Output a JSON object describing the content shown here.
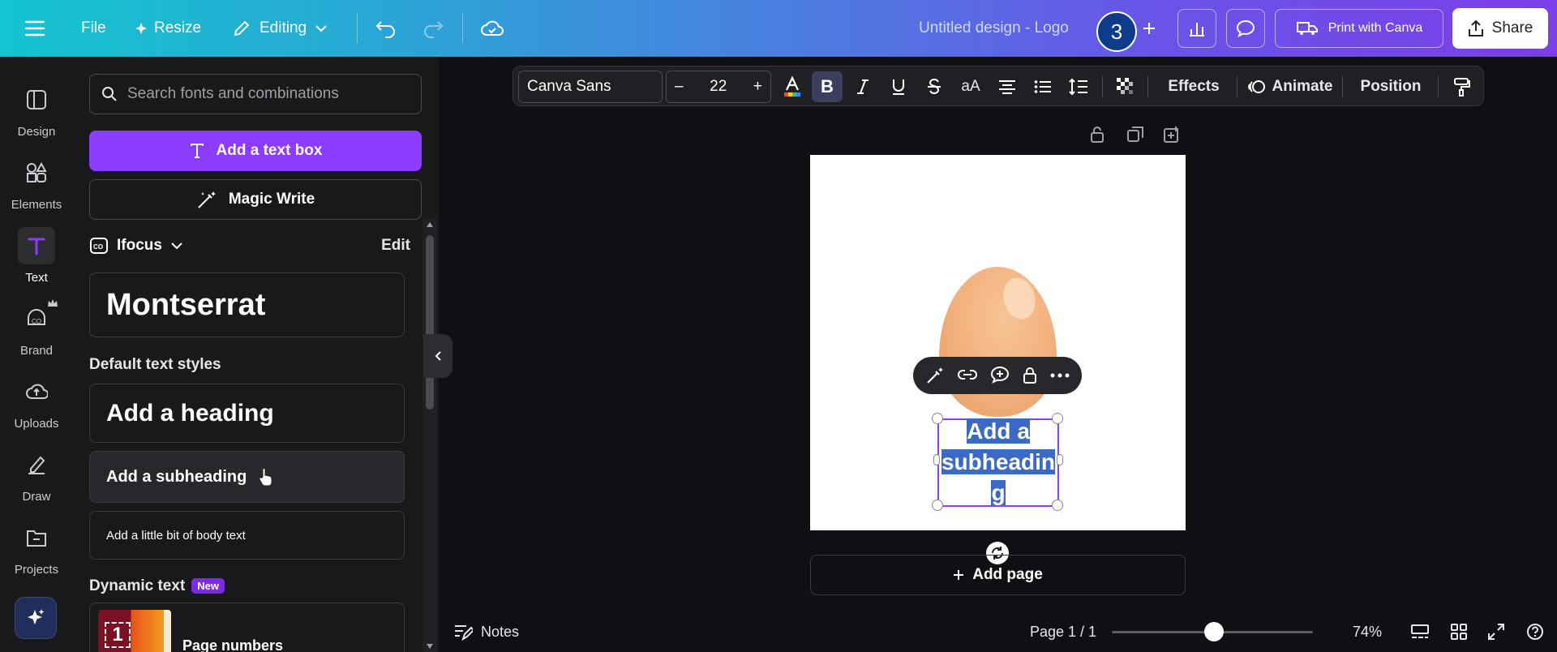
{
  "topbar": {
    "file": "File",
    "resize": "Resize",
    "editing": "Editing",
    "title": "Untitled design - Logo",
    "avatar_count": "3",
    "print": "Print with Canva",
    "share": "Share"
  },
  "rail": {
    "items": [
      {
        "label": "Design",
        "icon": "design-icon"
      },
      {
        "label": "Elements",
        "icon": "elements-icon"
      },
      {
        "label": "Text",
        "icon": "text-icon"
      },
      {
        "label": "Brand",
        "icon": "brand-icon"
      },
      {
        "label": "Uploads",
        "icon": "uploads-icon"
      },
      {
        "label": "Draw",
        "icon": "draw-icon"
      },
      {
        "label": "Projects",
        "icon": "projects-icon"
      }
    ],
    "active": "Text"
  },
  "panel": {
    "search_placeholder": "Search fonts and combinations",
    "add_text_box": "Add a text box",
    "magic_write": "Magic Write",
    "brand_kit": "Ifocus",
    "edit": "Edit",
    "brand_font": "Montserrat",
    "default_styles": "Default text styles",
    "heading": "Add a heading",
    "subheading": "Add a subheading",
    "body": "Add a little bit of body text",
    "dynamic_text": "Dynamic text",
    "new_badge": "New",
    "page_numbers": "Page numbers",
    "page_number_glyph": "1"
  },
  "format_toolbar": {
    "font": "Canva Sans",
    "minus": "–",
    "size": "22",
    "plus": "+",
    "bold": "B",
    "case": "aA",
    "effects": "Effects",
    "animate": "Animate",
    "position": "Position"
  },
  "canvas": {
    "selected_text_lines": [
      "Add a",
      "subheadin",
      "g"
    ],
    "add_page": "Add page"
  },
  "bottom": {
    "notes": "Notes",
    "page": "Page 1 / 1",
    "zoom": "74%",
    "zoom_value": 74
  },
  "colors": {
    "accent": "#8b3dff",
    "selection": "#3a69c6"
  }
}
